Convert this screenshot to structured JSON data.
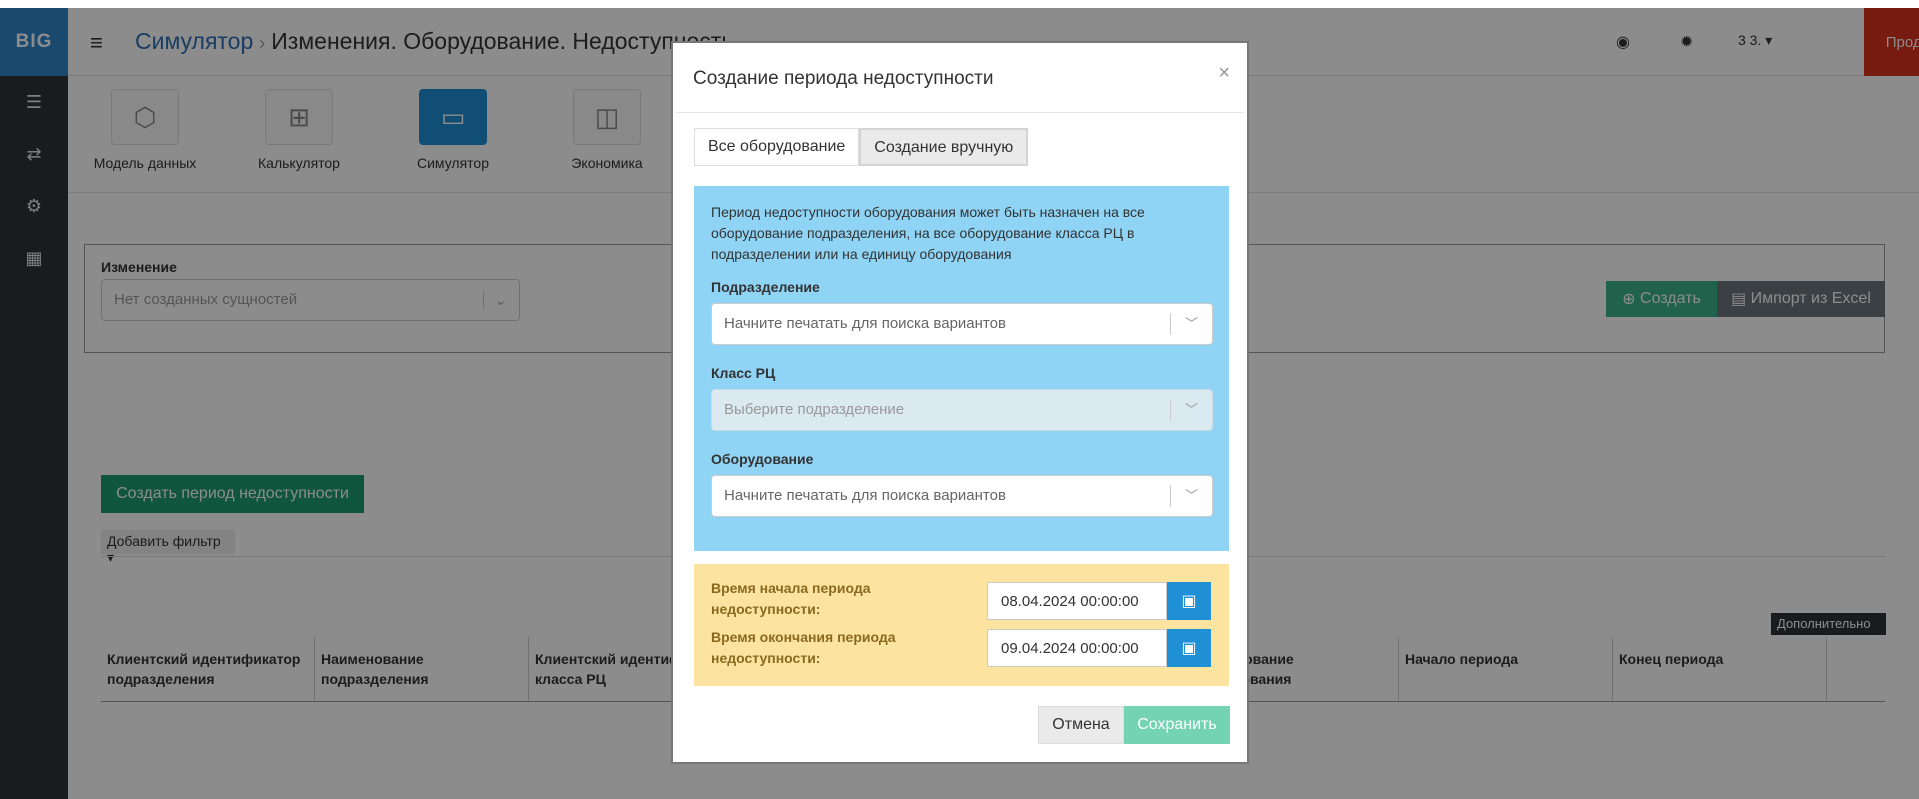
{
  "sidebar": {
    "logo": "BIG",
    "icons": [
      "list-icon",
      "exchange-icon",
      "settings-cluster-icon",
      "calculator-icon"
    ]
  },
  "header": {
    "breadcrumb_link": "Симулятор",
    "page_title": "Изменения. Оборудование. Недоступность",
    "user_label": "3 3.",
    "products_label": "Продукты"
  },
  "apps": [
    {
      "label": "Модель данных"
    },
    {
      "label": "Калькулятор"
    },
    {
      "label": "Симулятор"
    },
    {
      "label": "Экономика"
    }
  ],
  "change_panel": {
    "label": "Изменение",
    "select_placeholder": "Нет созданных сущностей",
    "create_label": "Создать",
    "import_label": "Импорт из Excel"
  },
  "list": {
    "create_period_label": "Создать период недоступности",
    "add_filter_label": "Добавить фильтр",
    "more_label": "Дополнительно",
    "columns": [
      "Клиентский идентификатор подразделения",
      "Наименование подразделения",
      "Клиентский идентификатор класса РЦ",
      "Наименование оборудования",
      "Начало периода",
      "Конец периода"
    ]
  },
  "modal": {
    "title": "Создание периода недоступности",
    "close": "×",
    "tabs": [
      {
        "label": "Все оборудование"
      },
      {
        "label": "Создание вручную"
      }
    ],
    "note": "Период недоступности оборудования может быть назначен на все оборудование подразделения, на все оборудование класса РЦ в подразделении или на единицу оборудования",
    "fields": {
      "department_label": "Подразделение",
      "department_placeholder": "Начните печатать для поиска вариантов",
      "class_label": "Класс РЦ",
      "class_placeholder": "Выберите подразделение",
      "equipment_label": "Оборудование",
      "equipment_placeholder": "Начните печатать для поиска вариантов"
    },
    "time": {
      "start_label": "Время начала периода недоступности:",
      "start_value": "08.04.2024 00:00:00",
      "end_label": "Время окончания периода недоступности:",
      "end_value": "09.04.2024 00:00:00"
    },
    "cancel_label": "Отмена",
    "save_label": "Сохранить"
  },
  "colors": {
    "accent_blue": "#1f8fd6",
    "products_red": "#d9321f",
    "info_bg": "#8fd3f5",
    "time_bg": "#fde3a0",
    "save_green": "#74d3b3"
  }
}
